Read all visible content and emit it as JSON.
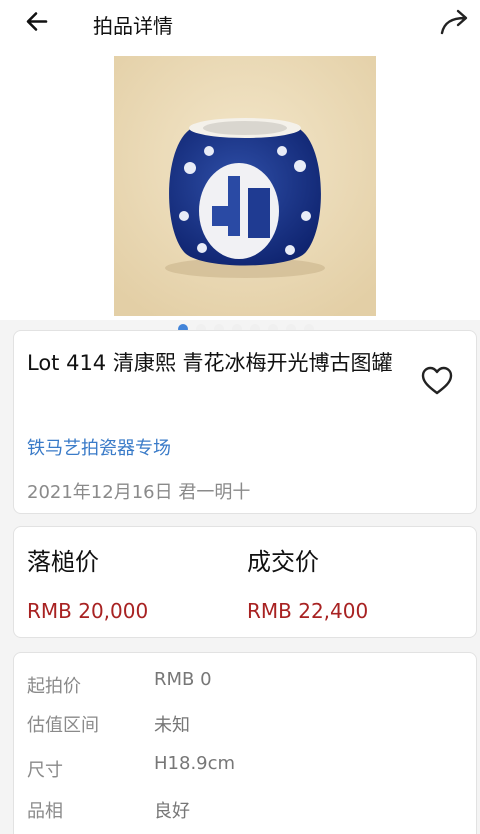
{
  "header": {
    "title": "拍品详情",
    "back_icon": "arrow-left-icon",
    "share_icon": "share-icon"
  },
  "gallery": {
    "image_count": 8,
    "active_index": 0
  },
  "lot": {
    "title": "Lot 414 清康熙 青花冰梅开光博古图罐",
    "session": "铁马艺拍瓷器专场",
    "date_auctioneer": "2021年12月16日 君一明十",
    "favorite_icon": "heart-outline-icon"
  },
  "prices": {
    "hammer_label": "落槌价",
    "hammer_value": "RMB 20,000",
    "deal_label": "成交价",
    "deal_value": "RMB 22,400"
  },
  "details": [
    {
      "label": "起拍价",
      "value": "RMB 0"
    },
    {
      "label": "估值区间",
      "value": "未知"
    },
    {
      "label": "尺寸",
      "value": "H18.9cm"
    },
    {
      "label": "品相",
      "value": "良好"
    }
  ],
  "colors": {
    "accent_blue": "#2f78d6",
    "link_blue": "#3a7bc8",
    "price_red": "#a82222"
  }
}
